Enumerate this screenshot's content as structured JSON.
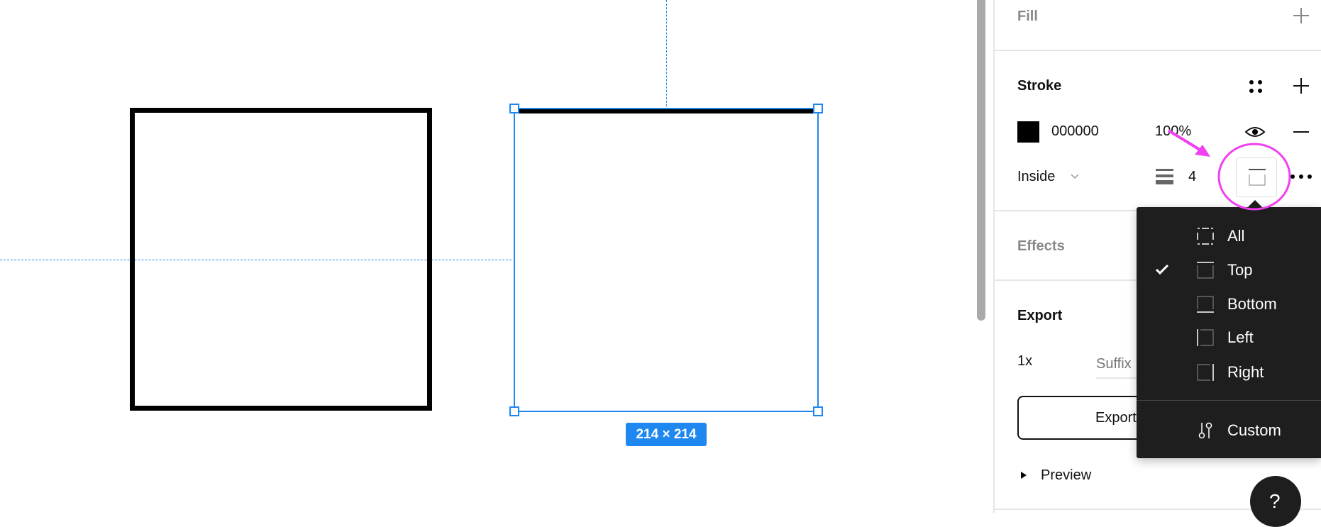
{
  "canvas": {
    "dimension_label": "214 × 214",
    "selection_color": "#1e88f0"
  },
  "panel": {
    "fill": {
      "title": "Fill"
    },
    "stroke": {
      "title": "Stroke",
      "color_hex": "000000",
      "opacity": "100%",
      "position": "Inside",
      "weight": "4"
    },
    "effects": {
      "title": "Effects"
    },
    "export": {
      "title": "Export",
      "scale": "1x",
      "suffix_placeholder": "Suffix",
      "button_label": "Export",
      "preview_label": "Preview"
    },
    "help_label": "?"
  },
  "stroke_sides_menu": {
    "items": [
      {
        "label": "All",
        "checked": false
      },
      {
        "label": "Top",
        "checked": true
      },
      {
        "label": "Bottom",
        "checked": false
      },
      {
        "label": "Left",
        "checked": false
      },
      {
        "label": "Right",
        "checked": false
      }
    ],
    "custom_label": "Custom"
  },
  "annotation_color": "#f040f0"
}
